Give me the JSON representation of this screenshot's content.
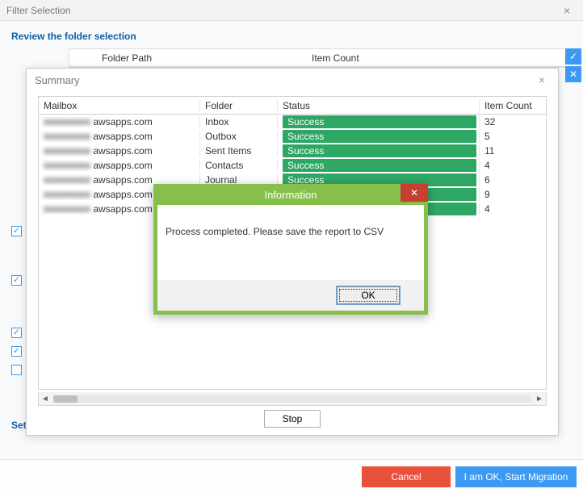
{
  "filter": {
    "title": "Filter Selection",
    "review": "Review the folder selection",
    "col_folder": "Folder Path",
    "col_item": "Item Count",
    "set_label": "Set",
    "cancel": "Cancel",
    "start": "I am OK, Start Migration"
  },
  "side": {
    "check": "✓",
    "x": "✕"
  },
  "summary": {
    "title": "Summary",
    "close": "×",
    "headers": {
      "mailbox": "Mailbox",
      "folder": "Folder",
      "status": "Status",
      "count": "Item Count"
    },
    "rows": [
      {
        "mailbox_masked": "■■■■■■■■",
        "mailbox_domain": "awsapps.com",
        "folder": "Inbox",
        "status": "Success",
        "count": "32"
      },
      {
        "mailbox_masked": "■■■■■■■■",
        "mailbox_domain": "awsapps.com",
        "folder": "Outbox",
        "status": "Success",
        "count": "5"
      },
      {
        "mailbox_masked": "■■■■■■■■",
        "mailbox_domain": "awsapps.com",
        "folder": "Sent Items",
        "status": "Success",
        "count": "11"
      },
      {
        "mailbox_masked": "■■■■■■■■",
        "mailbox_domain": "awsapps.com",
        "folder": "Contacts",
        "status": "Success",
        "count": "4"
      },
      {
        "mailbox_masked": "■■■■■■■■",
        "mailbox_domain": "awsapps.com",
        "folder": "Journal",
        "status": "Success",
        "count": "6"
      },
      {
        "mailbox_masked": "■■■■■■■■",
        "mailbox_domain": "awsapps.com",
        "folder": "",
        "status": "Success",
        "count": "9"
      },
      {
        "mailbox_masked": "■■■■■■■■",
        "mailbox_domain": "awsapps.com",
        "folder": "",
        "status": "Success",
        "count": "4"
      }
    ],
    "stop": "Stop"
  },
  "info": {
    "title": "Information",
    "close": "✕",
    "message": "Process completed. Please save the report to CSV",
    "ok": "OK"
  }
}
